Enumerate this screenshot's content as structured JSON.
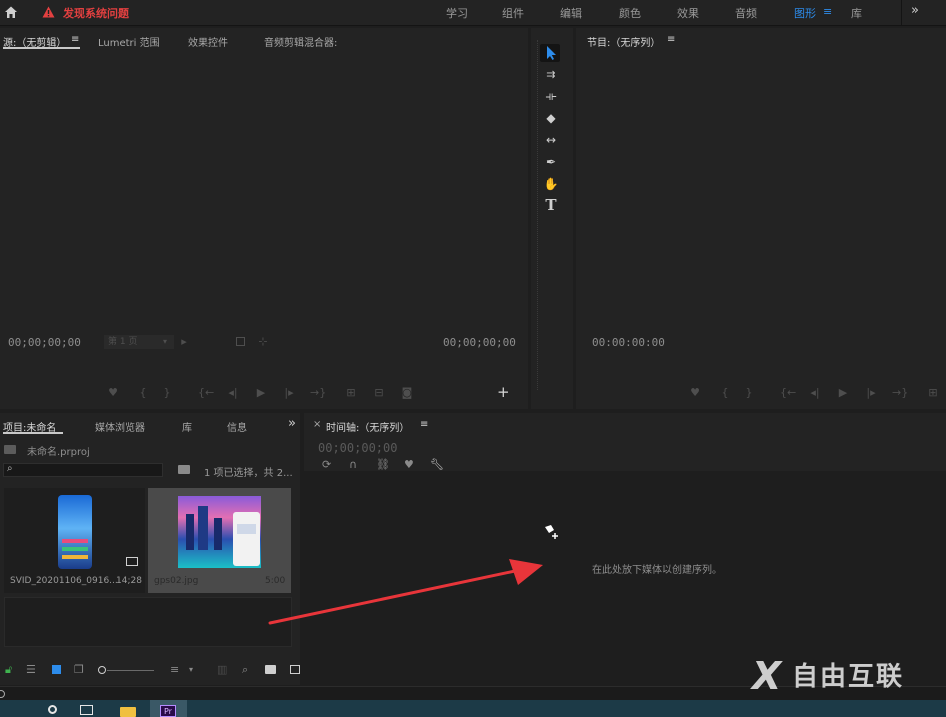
{
  "topbar": {
    "home_icon": "home-icon",
    "alert_text": "发现系统问题",
    "alert_color": "#e34040",
    "workspaces": [
      "学习",
      "组件",
      "编辑",
      "颜色",
      "效果",
      "音频",
      "图形",
      "库"
    ],
    "active_workspace": "图形",
    "menu_glyph": "≡",
    "more_glyph": "»"
  },
  "source_panel": {
    "tabs": [
      "源:（无剪辑）",
      "Lumetri 范围",
      "效果控件",
      "音频剪辑混合器:"
    ],
    "menu_glyph": "≡",
    "timecode_left": "00;00;00;00",
    "page_select": "第 1 页",
    "timecode_right": "00;00;00;00",
    "add_glyph": "+"
  },
  "program_panel": {
    "title": "节目:（无序列）",
    "menu_glyph": "≡",
    "timecode": "00:00:00:00"
  },
  "project_panel": {
    "tabs": [
      "项目:未命名",
      "媒体浏览器",
      "库",
      "信息"
    ],
    "more_glyph": "»",
    "project_file": "未命名.prproj",
    "selection_info": "1 项已选择，共 2...",
    "items": [
      {
        "name": "SVID_20201106_0916...",
        "duration": "14;28"
      },
      {
        "name": "gps02.jpg",
        "duration": "5:00"
      }
    ]
  },
  "timeline_panel": {
    "close_glyph": "×",
    "title": "时间轴:（无序列）",
    "menu_glyph": "≡",
    "timecode": "00;00;00;00",
    "drop_hint": "在此处放下媒体以创建序列。"
  },
  "watermark": {
    "text": "自由互联",
    "logo": "X"
  },
  "annotation": {
    "arrow_color": "#e8353a"
  }
}
